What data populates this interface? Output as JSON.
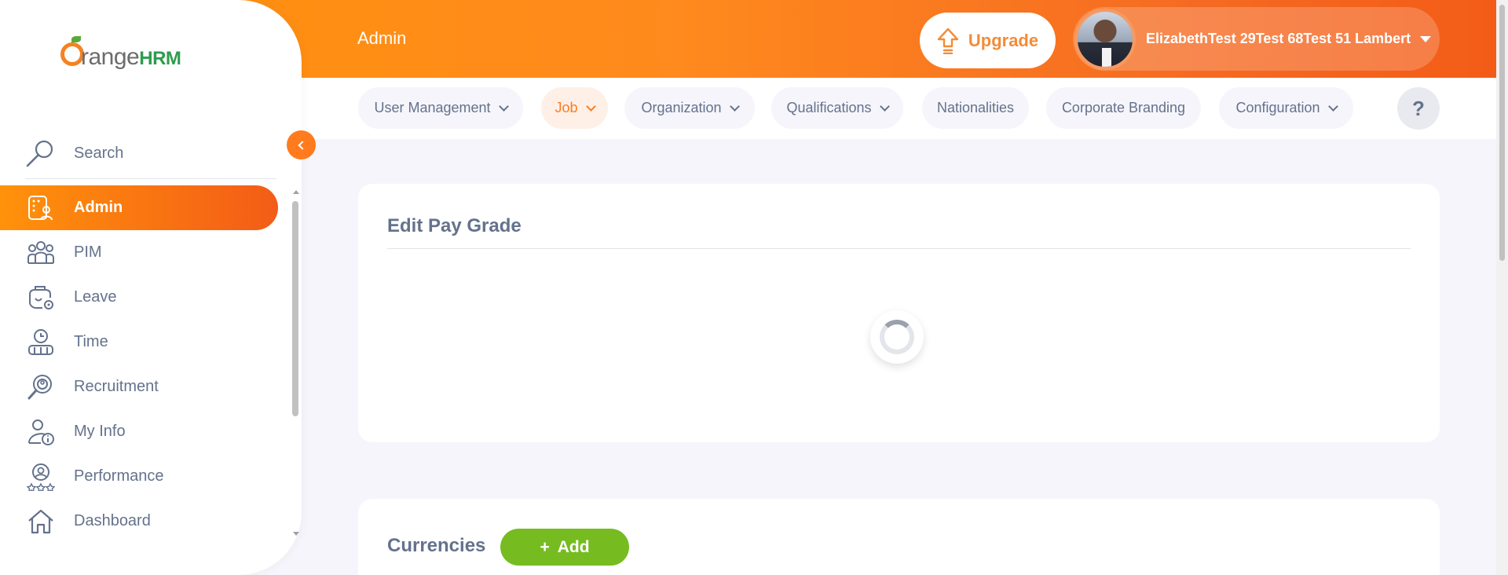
{
  "brand": {
    "name_prefix": "range",
    "name_suffix": "HRM"
  },
  "header": {
    "page_title": "Admin",
    "upgrade_label": "Upgrade",
    "user_name": "ElizabethTest 29Test 68Test 51 Lambert"
  },
  "sidebar": {
    "search_label": "Search",
    "items": [
      {
        "label": "Admin",
        "icon": "admin-icon",
        "active": true
      },
      {
        "label": "PIM",
        "icon": "pim-icon"
      },
      {
        "label": "Leave",
        "icon": "leave-icon"
      },
      {
        "label": "Time",
        "icon": "time-icon"
      },
      {
        "label": "Recruitment",
        "icon": "recruitment-icon"
      },
      {
        "label": "My Info",
        "icon": "my-info-icon"
      },
      {
        "label": "Performance",
        "icon": "performance-icon"
      },
      {
        "label": "Dashboard",
        "icon": "dashboard-icon"
      }
    ]
  },
  "subnav": {
    "tabs": [
      {
        "label": "User Management",
        "has_dropdown": true
      },
      {
        "label": "Job",
        "has_dropdown": true,
        "active": true
      },
      {
        "label": "Organization",
        "has_dropdown": true
      },
      {
        "label": "Qualifications",
        "has_dropdown": true
      },
      {
        "label": "Nationalities"
      },
      {
        "label": "Corporate Branding"
      },
      {
        "label": "Configuration",
        "has_dropdown": true
      }
    ],
    "help_label": "?"
  },
  "edit_card": {
    "title": "Edit Pay Grade"
  },
  "currency_card": {
    "title": "Currencies",
    "add_label": "Add",
    "add_prefix": "+"
  },
  "colors": {
    "accent": "#ff7b1d",
    "add_button": "#76bc21",
    "text": "#64728c"
  }
}
